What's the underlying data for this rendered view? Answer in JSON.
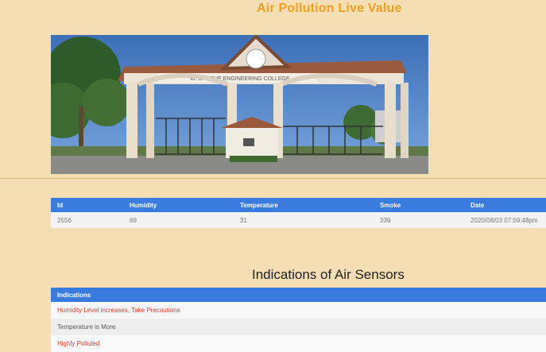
{
  "page": {
    "title": "Air Pollution Live Value"
  },
  "photo": {
    "alt": "college gate photo",
    "arch_sign": "M. S. BIDVE ENGINEERING COLLEGE"
  },
  "readings": {
    "headers": [
      "Id",
      "Humidity",
      "Temperature",
      "Smoke",
      "Date"
    ],
    "row": {
      "id": "2556",
      "humidity": "69",
      "temperature": "31",
      "smoke": "339",
      "date": "2020/08/03 07:59:48pm"
    }
  },
  "indications": {
    "section_title": "Indications of Air Sensors",
    "header": "Indications",
    "items": [
      "Humidity Level increases, Take Precautions",
      "Temperature is More",
      "Highly Polluted"
    ]
  },
  "colors": {
    "background": "#f5deb3",
    "title": "#f0a020",
    "table_header": "#3a7be0",
    "alert_text": "#e03a2a"
  }
}
